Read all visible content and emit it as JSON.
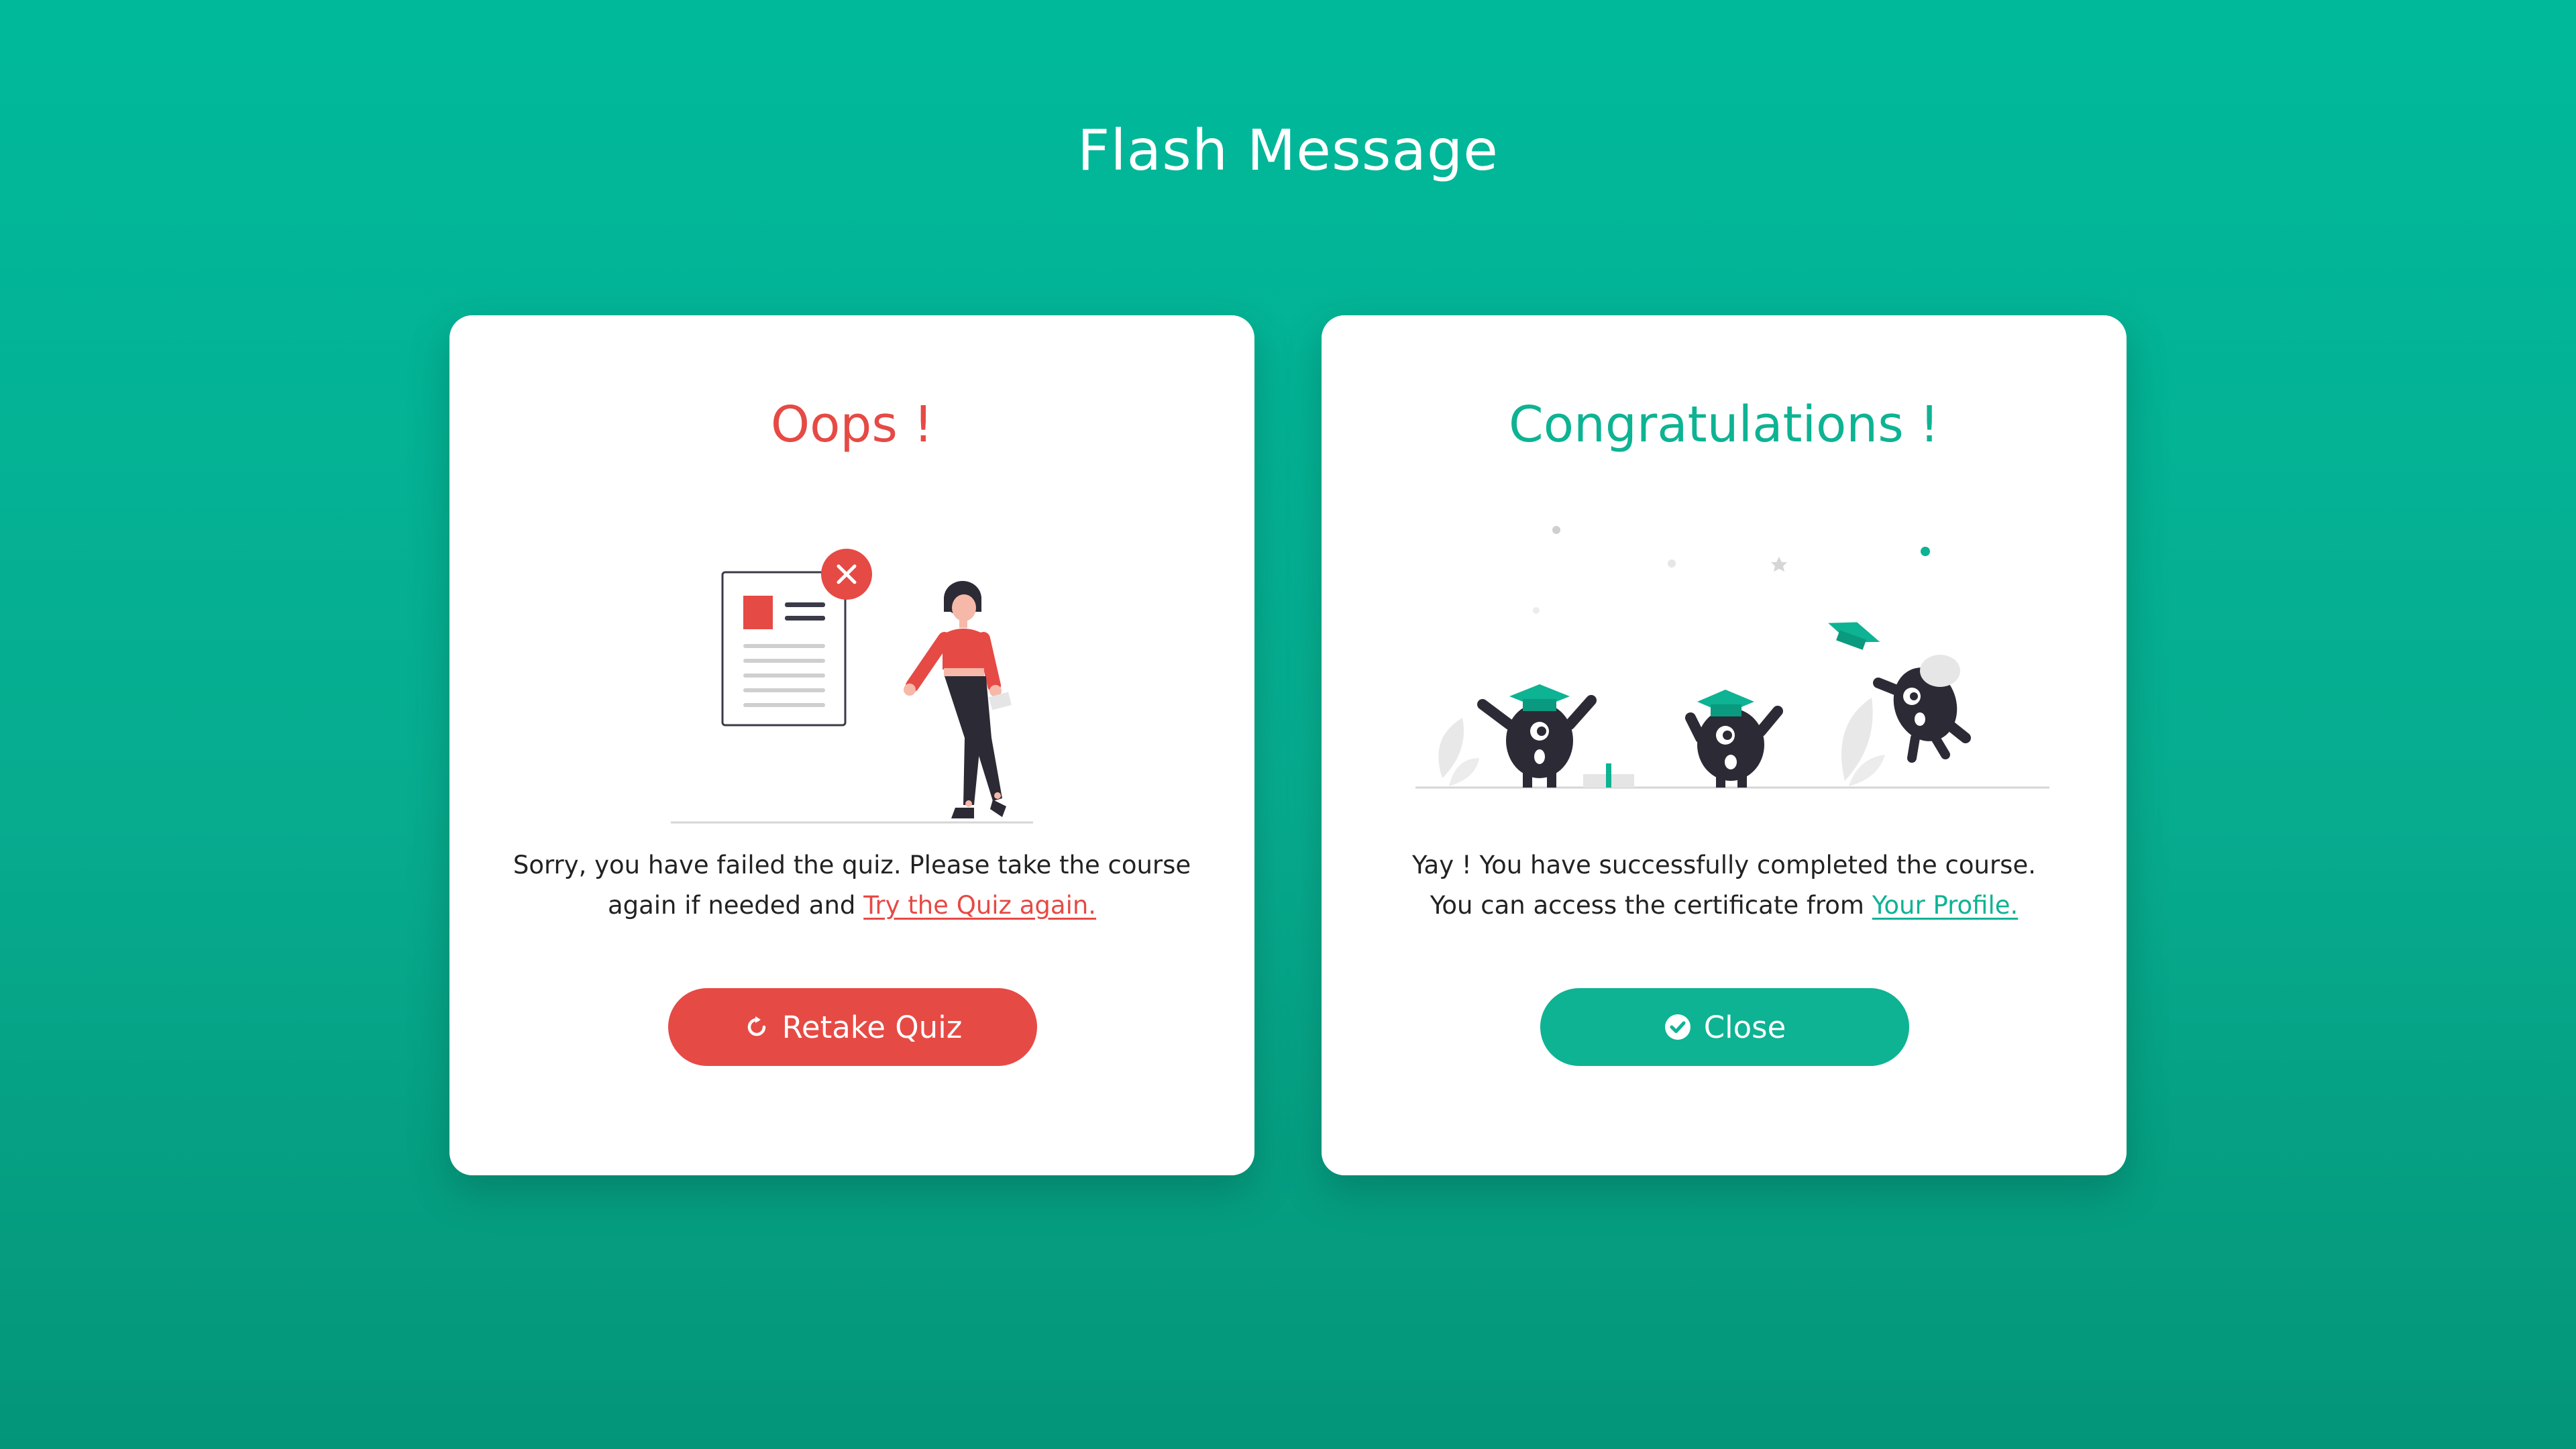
{
  "page": {
    "title": "Flash Message"
  },
  "colors": {
    "background_top": "#00b99b",
    "background_bottom": "#049579",
    "error": "#e64a45",
    "success": "#0db393",
    "text": "#222222"
  },
  "fail_card": {
    "title": "Oops !",
    "message_part1": "Sorry, you have failed the quiz. Please take the course again if needed and ",
    "link_label": "Try the Quiz again.",
    "button_label": "Retake Quiz",
    "button_icon": "refresh-icon",
    "illustration": "woman-walking-away-from-failed-document"
  },
  "success_card": {
    "title": "Congratulations !",
    "message_line1": "Yay ! You have successfully completed the course.",
    "message_part2": "You can access the certificate from ",
    "link_label": "Your Profile.",
    "button_label": "Close",
    "button_icon": "check-circle-icon",
    "illustration": "graduating-monsters-with-caps"
  }
}
